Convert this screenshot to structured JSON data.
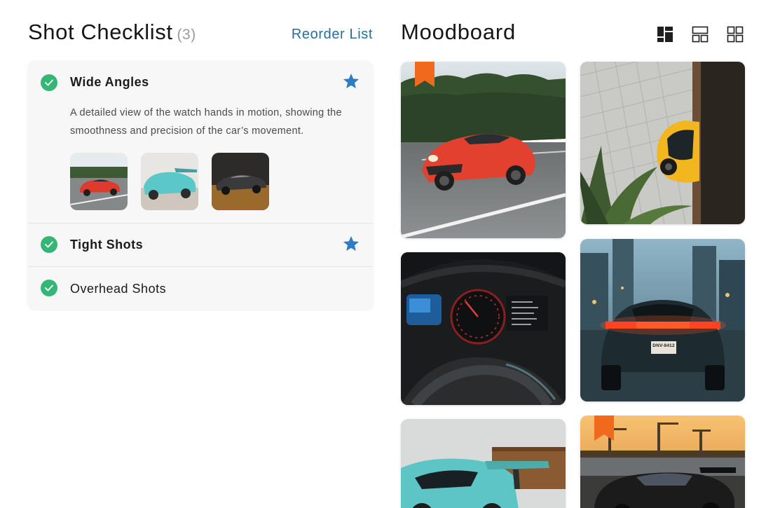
{
  "checklist": {
    "title": "Shot Checklist",
    "count": "(3)",
    "reorder_label": "Reorder List",
    "items": [
      {
        "label": "Wide Angles",
        "checked": true,
        "starred": true,
        "description": "A detailed view of the watch hands in motion, showing the smoothness and precision of the car’s movement.",
        "thumbnails": [
          "red-porsche-thumbnail",
          "teal-porsche-thumbnail",
          "black-car-thumbnail"
        ]
      },
      {
        "label": "Tight Shots",
        "checked": true,
        "starred": true
      },
      {
        "label": "Overhead Shots",
        "checked": true,
        "starred": false
      }
    ]
  },
  "moodboard": {
    "title": "Moodboard",
    "view_options": [
      "masonry-view-icon",
      "list-view-icon",
      "grid-view-icon"
    ],
    "photos": [
      {
        "subject": "red Porsche 911 driving on road",
        "bookmarked": true
      },
      {
        "subject": "yellow car from above with plants",
        "bookmarked": false
      },
      {
        "subject": "car dashboard instrument cluster",
        "bookmarked": false
      },
      {
        "subject": "Porsche rear with tail lights on city street",
        "bookmarked": false,
        "plate": "DNV-8412"
      },
      {
        "subject": "teal Porsche GT3 with rear wing",
        "bookmarked": false
      },
      {
        "subject": "black Porsche at harbor sunset",
        "bookmarked": true
      }
    ]
  },
  "colors": {
    "accent_link": "#2a6f97",
    "check_green": "#35b676",
    "star_blue": "#2d7dc2",
    "bookmark_orange": "#f06a1d"
  }
}
